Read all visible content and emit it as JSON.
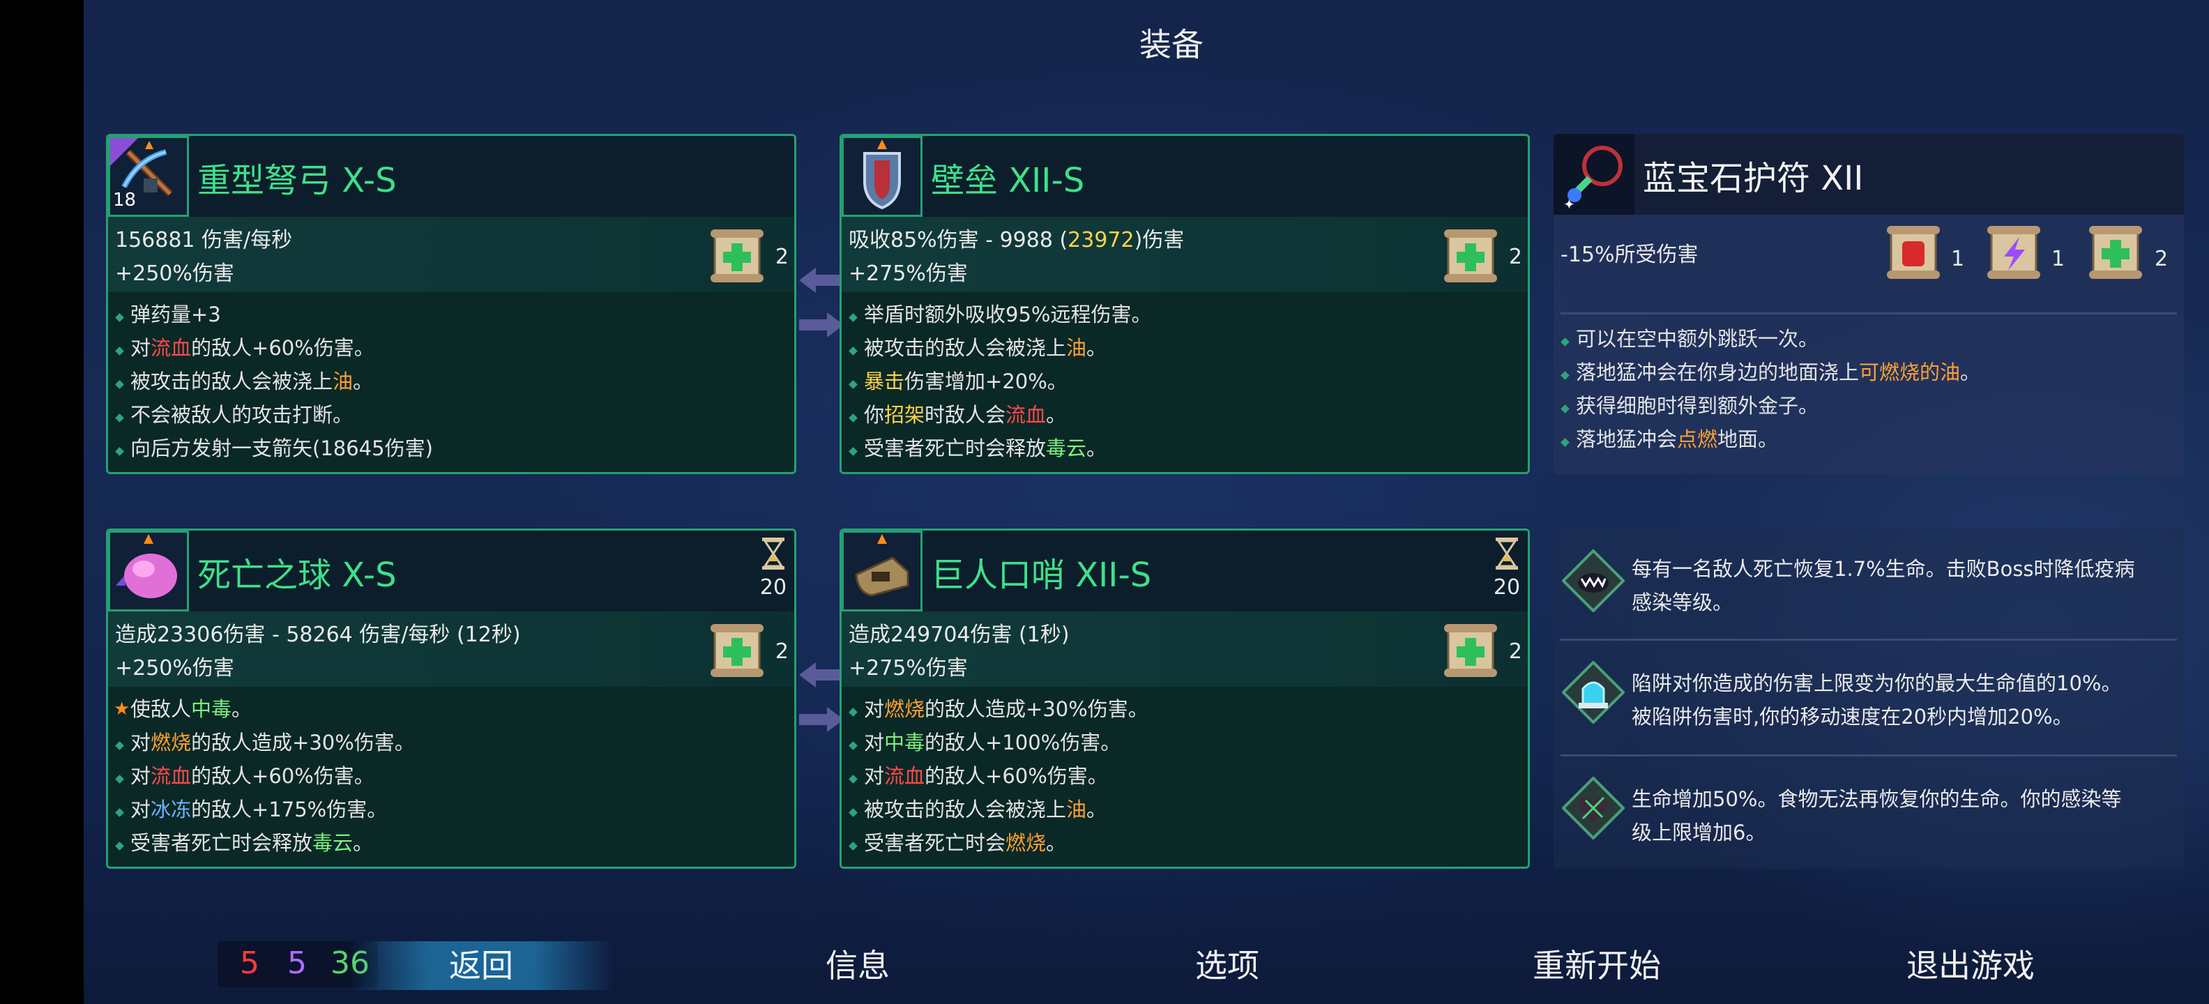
{
  "title": "装备",
  "weapons": [
    {
      "name": "重型弩弓 X-S",
      "level_badge": "18",
      "stat1": "156881 伤害/每秒",
      "stat2": "+250%伤害",
      "scroll_count": "2",
      "effects": [
        {
          "parts": [
            "弹药量+3"
          ]
        },
        {
          "parts": [
            "对",
            "流血",
            "的敌人+60%伤害。"
          ],
          "hl": [
            1
          ],
          "color": "red"
        },
        {
          "parts": [
            "被攻击的敌人会被浇上",
            "油",
            "。"
          ],
          "hl": [
            1
          ],
          "color": "orange"
        },
        {
          "parts": [
            "不会被敌人的攻击打断。"
          ]
        },
        {
          "parts": [
            "向后方发射一支箭矢(18645伤害)"
          ]
        }
      ]
    },
    {
      "name": "壁垒 XII-S",
      "stat1_a": "吸收85%伤害 - 9988 (",
      "stat1_b": "23972",
      "stat1_c": ")伤害",
      "stat2": "+275%伤害",
      "scroll_count": "2",
      "effects": [
        {
          "parts": [
            "举盾时额外吸收95%远程伤害。"
          ]
        },
        {
          "parts": [
            "被攻击的敌人会被浇上",
            "油",
            "。"
          ],
          "hl": [
            1
          ],
          "color": "orange"
        },
        {
          "parts": [
            "暴击",
            "伤害增加+20%。"
          ],
          "hl": [
            0
          ],
          "color": "yellow"
        },
        {
          "parts": [
            "你",
            "招架",
            "时敌人会",
            "流血",
            "。"
          ],
          "hl": [
            1,
            3
          ],
          "colors": [
            "yellow",
            "red"
          ]
        },
        {
          "parts": [
            "受害者死亡时会释放",
            "毒云",
            "。"
          ],
          "hl": [
            1
          ],
          "color": "green"
        }
      ]
    }
  ],
  "amulet": {
    "name": "蓝宝石护符 XII",
    "stat": "-15%所受伤害",
    "scrolls": [
      {
        "kind": "brutality",
        "count": "1"
      },
      {
        "kind": "tactics",
        "count": "1"
      },
      {
        "kind": "survival",
        "count": "2"
      }
    ],
    "effects": [
      {
        "parts": [
          "可以在空中额外跳跃一次。"
        ]
      },
      {
        "parts": [
          "落地猛冲会在你身边的地面浇上",
          "可燃烧的油",
          "。"
        ],
        "hl": [
          1
        ],
        "color": "orange"
      },
      {
        "parts": [
          "获得细胞时得到额外金子。"
        ]
      },
      {
        "parts": [
          "落地猛冲会",
          "点燃",
          "地面。"
        ],
        "hl": [
          1
        ],
        "color": "orange"
      }
    ]
  },
  "skills": [
    {
      "name": "死亡之球 X-S",
      "cooldown": "20",
      "stat1": "造成23306伤害 - 58264 伤害/每秒 (12秒)",
      "stat2": "+250%伤害",
      "scroll_count": "2",
      "effects": [
        {
          "star": true,
          "parts": [
            "使敌人",
            "中毒",
            "。"
          ],
          "hl": [
            1
          ],
          "color": "green"
        },
        {
          "parts": [
            "对",
            "燃烧",
            "的敌人造成+30%伤害。"
          ],
          "hl": [
            1
          ],
          "color": "orange"
        },
        {
          "parts": [
            "对",
            "流血",
            "的敌人+60%伤害。"
          ],
          "hl": [
            1
          ],
          "color": "red"
        },
        {
          "parts": [
            "对",
            "冰冻",
            "的敌人+175%伤害。"
          ],
          "hl": [
            1
          ],
          "color": "blue"
        },
        {
          "parts": [
            "受害者死亡时会释放",
            "毒云",
            "。"
          ],
          "hl": [
            1
          ],
          "color": "green"
        }
      ]
    },
    {
      "name": "巨人口哨 XII-S",
      "cooldown": "20",
      "stat1": "造成249704伤害 (1秒)",
      "stat2": "+275%伤害",
      "scroll_count": "2",
      "effects": [
        {
          "parts": [
            "对",
            "燃烧",
            "的敌人造成+30%伤害。"
          ],
          "hl": [
            1
          ],
          "color": "orange"
        },
        {
          "parts": [
            "对",
            "中毒",
            "的敌人+100%伤害。"
          ],
          "hl": [
            1
          ],
          "color": "green"
        },
        {
          "parts": [
            "对",
            "流血",
            "的敌人+60%伤害。"
          ],
          "hl": [
            1
          ],
          "color": "red"
        },
        {
          "parts": [
            "被攻击的敌人会被浇上",
            "油",
            "。"
          ],
          "hl": [
            1
          ],
          "color": "orange"
        },
        {
          "parts": [
            "受害者死亡时会",
            "燃烧",
            "。"
          ],
          "hl": [
            1
          ],
          "color": "orange"
        }
      ]
    }
  ],
  "mutations": [
    {
      "icon": "vampire-mouth-icon",
      "lines": [
        "每有一名敌人死亡恢复1.7%生命。击败Boss时降低疫病",
        "感染等级。"
      ]
    },
    {
      "icon": "trap-shield-icon",
      "lines": [
        "陷阱对你造成的伤害上限变为你的最大生命值的10%。",
        "被陷阱伤害时,你的移动速度在20秒内增加20%。"
      ]
    },
    {
      "icon": "thorn-heart-icon",
      "lines": [
        "生命增加50%。食物无法再恢复你的生命。你的感染等",
        "级上限增加6。"
      ]
    }
  ],
  "stats_counter": {
    "brutality": "5",
    "tactics": "5",
    "survival": "36",
    "colors": {
      "brutality": "#ff3b3b",
      "tactics": "#b06cff",
      "survival": "#58d46a"
    }
  },
  "menu": {
    "back": "返回",
    "info": "信息",
    "options": "选项",
    "restart": "重新开始",
    "quit": "退出游戏"
  },
  "colors": {
    "card_border": "#25a074",
    "name_green": "#3ee08a",
    "red": "#ff4b4b",
    "orange": "#ffa032",
    "green": "#7df07d",
    "yellow": "#ffd24a",
    "blue": "#6fb3ff"
  }
}
